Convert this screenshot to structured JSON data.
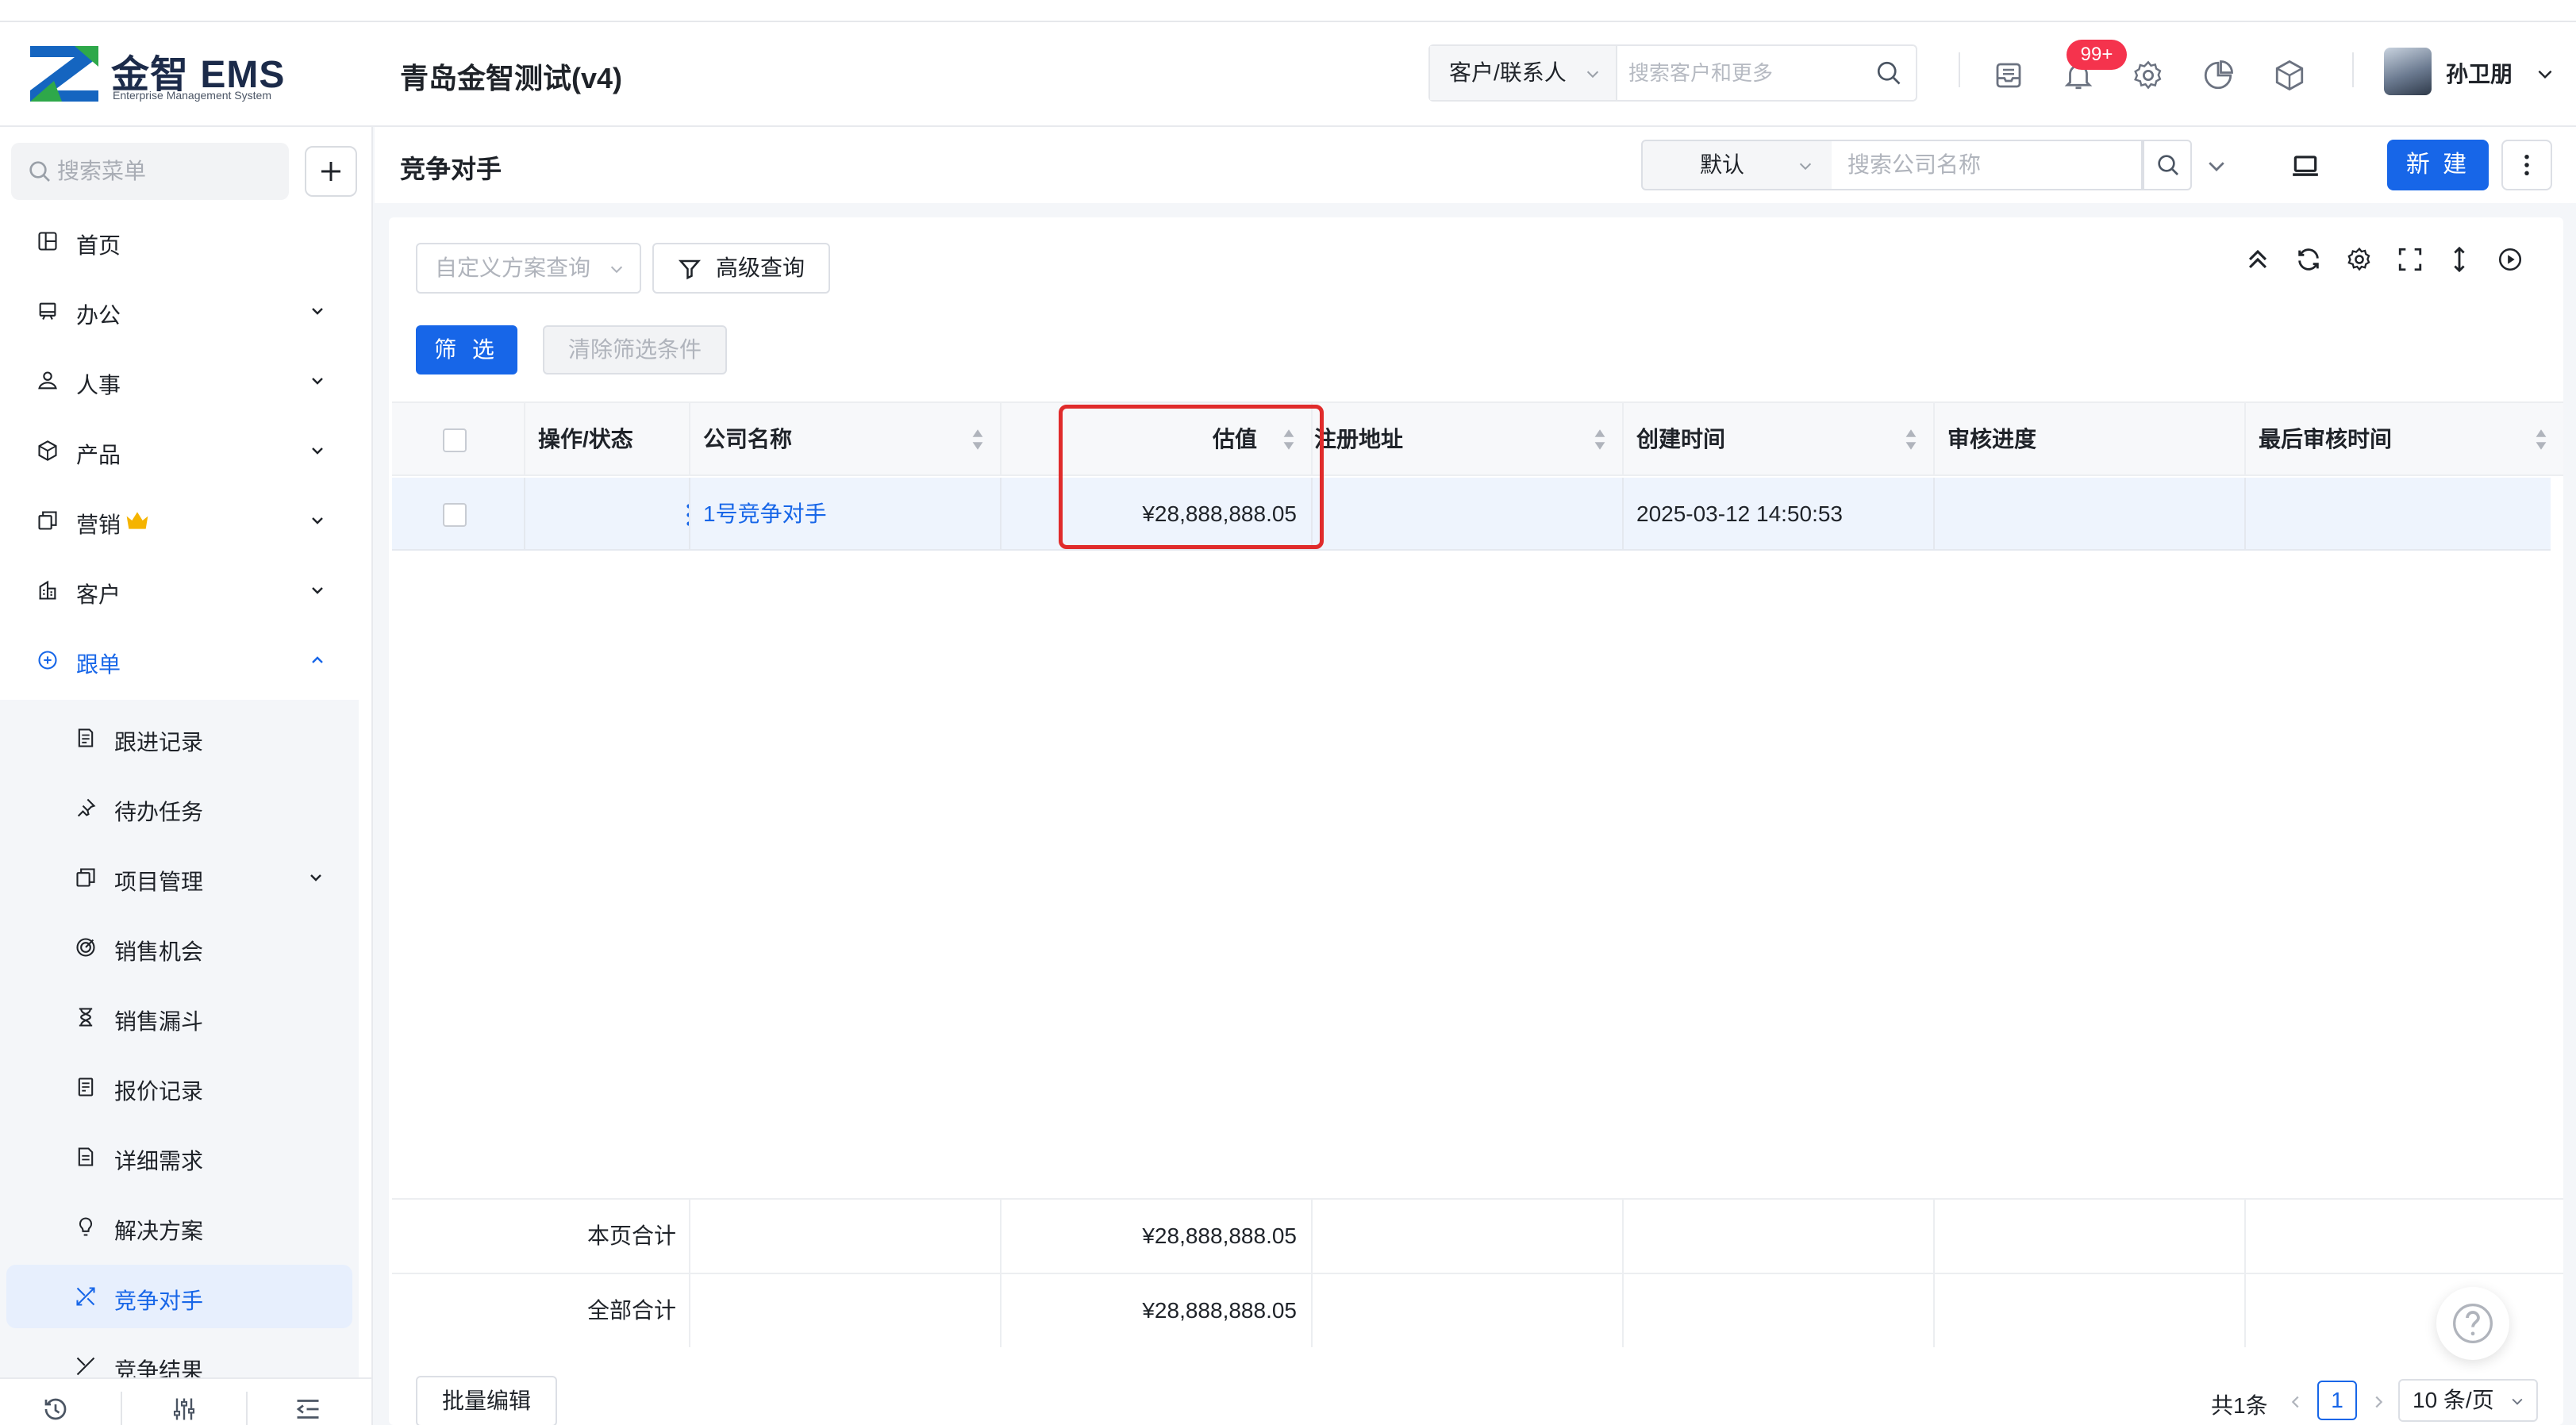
{
  "app": {
    "logo_text": "金智 EMS",
    "logo_subtitle": "Enterprise Management System",
    "tenant_name": "青岛金智测试(v4)",
    "brand_color": "#1766e8"
  },
  "header": {
    "search_scope": "客户/联系人",
    "search_placeholder": "搜索客户和更多",
    "notification_count": "99+",
    "user_name": "孙卫朋",
    "icons": [
      "inbox-icon",
      "bell-icon",
      "gear-icon",
      "pie-chart-icon",
      "cube-icon"
    ]
  },
  "sidebar": {
    "search_placeholder": "搜索菜单",
    "items": [
      {
        "label": "首页",
        "icon": "home-icon"
      },
      {
        "label": "办公",
        "icon": "office-icon"
      },
      {
        "label": "人事",
        "icon": "people-icon"
      },
      {
        "label": "产品",
        "icon": "product-icon"
      },
      {
        "label": "营销",
        "icon": "marketing-icon",
        "badge_icon": "crown-icon"
      },
      {
        "label": "客户",
        "icon": "customer-icon"
      },
      {
        "label": "跟单",
        "icon": "follow-icon",
        "expanded": true
      }
    ],
    "sub_items": [
      {
        "label": "跟进记录",
        "icon": "record-icon"
      },
      {
        "label": "待办任务",
        "icon": "pin-icon"
      },
      {
        "label": "项目管理",
        "icon": "project-icon"
      },
      {
        "label": "销售机会",
        "icon": "target-icon"
      },
      {
        "label": "销售漏斗",
        "icon": "hourglass-icon"
      },
      {
        "label": "报价记录",
        "icon": "quote-icon"
      },
      {
        "label": "详细需求",
        "icon": "document-icon"
      },
      {
        "label": "解决方案",
        "icon": "bulb-icon"
      },
      {
        "label": "竞争对手",
        "icon": "competitor-icon",
        "active": true
      },
      {
        "label": "竞争结果",
        "icon": "result-icon"
      }
    ]
  },
  "page": {
    "title": "竞争对手",
    "scheme_select": "默认",
    "company_search_placeholder": "搜索公司名称",
    "new_button": "新 建"
  },
  "filters": {
    "custom_query_placeholder": "自定义方案查询",
    "advanced_query": "高级查询",
    "filter_button": "筛 选",
    "clear_button": "清除筛选条件"
  },
  "table": {
    "columns": [
      "操作/状态",
      "公司名称",
      "估值",
      "注册地址",
      "创建时间",
      "审核进度",
      "最后审核时间"
    ],
    "rows": [
      {
        "company": "1号竞争对手",
        "valuation": "¥28,888,888.05",
        "address": "",
        "created": "2025-03-12 14:50:53",
        "review_progress": "",
        "last_review": ""
      }
    ],
    "summary": {
      "page_total_label": "本页合计",
      "page_total_value": "¥28,888,888.05",
      "all_total_label": "全部合计",
      "all_total_value": "¥28,888,888.05"
    }
  },
  "footer": {
    "batch_edit": "批量编辑",
    "total": "共1条",
    "current_page": "1",
    "page_size": "10 条/页"
  }
}
